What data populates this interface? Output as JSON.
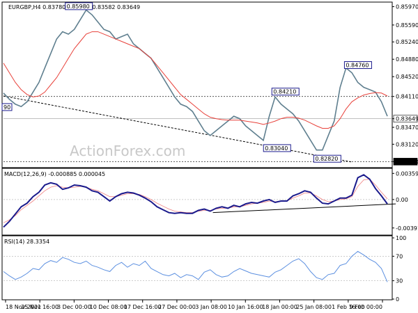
{
  "chart_data": [
    {
      "type": "line",
      "title": "EURGBP,H4  0.83780 0.83823 0.83582 0.83649",
      "watermark": "ActionForex.com",
      "ylim": [
        0.8265,
        0.8605
      ],
      "y_ticks": [
        "0.85970",
        "0.85590",
        "0.85240",
        "0.84880",
        "0.84520",
        "0.84110",
        "0.83649",
        "0.83470",
        "0.83120",
        "0.82760"
      ],
      "x_ticks": [
        "18 Nov 2021",
        "25 Nov 16:00",
        "3 Dec 00:00",
        "10 Dec 08:00",
        "17 Dec 16:00",
        "27 Dec 00:00",
        "3 Jan 08:00",
        "10 Jan 16:00",
        "18 Jan 00:00",
        "25 Jan 08:00",
        "1 Feb 16:00",
        "9 Feb 00:00"
      ],
      "annotations": [
        {
          "text": "0.85980",
          "x": "3 Dec 00:00",
          "y": 0.8598
        },
        {
          "text": "0.84210",
          "x": "18 Jan 00:00",
          "y": 0.8421
        },
        {
          "text": "0.84760",
          "x": "1 Feb 16:00",
          "y": 0.8476
        },
        {
          "text": "0.83040",
          "x": "18 Jan 00:00",
          "y": 0.8304
        },
        {
          "text": "0.82820",
          "x": "25 Jan 08:00",
          "y": 0.8282
        },
        {
          "text": "90",
          "x": "18 Nov 2021",
          "y": 0.8389
        }
      ],
      "current_price": "0.83649",
      "hline_level": "0.84110",
      "series": [
        {
          "values": [
            0.8418,
            0.8405,
            0.8395,
            0.839,
            0.84,
            0.842,
            0.844,
            0.847,
            0.85,
            0.853,
            0.8545,
            0.854,
            0.855,
            0.857,
            0.859,
            0.858,
            0.8565,
            0.855,
            0.8545,
            0.853,
            0.8535,
            0.854,
            0.852,
            0.851,
            0.85,
            0.849,
            0.847,
            0.845,
            0.843,
            0.841,
            0.8395,
            0.839,
            0.838,
            0.836,
            0.834,
            0.833,
            0.834,
            0.835,
            0.836,
            0.837,
            0.8365,
            0.835,
            0.834,
            0.833,
            0.832,
            0.837,
            0.841,
            0.8395,
            0.8385,
            0.8375,
            0.836,
            0.834,
            0.832,
            0.83,
            0.83,
            0.833,
            0.836,
            0.843,
            0.847,
            0.846,
            0.844,
            0.843,
            0.8425,
            0.842,
            0.84,
            0.837
          ]
        },
        {
          "values": [
            0.848,
            0.846,
            0.844,
            0.8425,
            0.8415,
            0.841,
            0.8412,
            0.842,
            0.8435,
            0.845,
            0.847,
            0.849,
            0.851,
            0.8525,
            0.854,
            0.8545,
            0.8545,
            0.854,
            0.8535,
            0.853,
            0.8525,
            0.852,
            0.8515,
            0.851,
            0.85,
            0.849,
            0.8475,
            0.846,
            0.8445,
            0.843,
            0.8415,
            0.8405,
            0.8395,
            0.8385,
            0.8375,
            0.8368,
            0.8365,
            0.8363,
            0.8362,
            0.8362,
            0.8362,
            0.836,
            0.8358,
            0.8356,
            0.8353,
            0.8356,
            0.836,
            0.8365,
            0.8368,
            0.8368,
            0.8366,
            0.8362,
            0.8356,
            0.835,
            0.8345,
            0.8345,
            0.835,
            0.8365,
            0.8385,
            0.84,
            0.8408,
            0.8414,
            0.8417,
            0.8419,
            0.8418,
            0.8412
          ]
        }
      ],
      "trendline": {
        "from": [
          0.8412,
          "18 Nov 2021"
        ],
        "to": [
          0.8275,
          "1 Feb 16:00"
        ]
      }
    },
    {
      "type": "line",
      "title": "MACD(12,26,9) -0.000885 0.000045",
      "ylim": [
        -0.0047,
        0.0041
      ],
      "y_ticks": [
        "0.003592",
        "0.00",
        "-0.003911"
      ],
      "series": [
        {
          "values": [
            -0.0038,
            -0.003,
            -0.002,
            -0.001,
            -0.0005,
            0.0004,
            0.001,
            0.002,
            0.0023,
            0.0021,
            0.0014,
            0.0016,
            0.002,
            0.0019,
            0.0017,
            0.0012,
            0.001,
            0.0004,
            -0.0002,
            0.0004,
            0.0008,
            0.001,
            0.0009,
            0.0006,
            0.0002,
            -0.0003,
            -0.001,
            -0.0014,
            -0.0018,
            -0.0019,
            -0.0018,
            -0.0019,
            -0.0019,
            -0.0015,
            -0.0013,
            -0.0016,
            -0.0012,
            -0.001,
            -0.0012,
            -0.0008,
            -0.001,
            -0.0006,
            -0.0004,
            -0.0005,
            -0.0002,
            0.0,
            -0.0004,
            -0.0002,
            -0.0002,
            0.0005,
            0.0008,
            0.0012,
            0.001,
            0.0002,
            -0.0005,
            -0.0006,
            -0.0002,
            0.0002,
            0.0002,
            0.0006,
            0.003,
            0.0034,
            0.0028,
            0.0015,
            0.0005,
            -0.0006
          ]
        },
        {
          "values": [
            -0.0032,
            -0.0028,
            -0.0022,
            -0.0014,
            -0.0008,
            -0.0002,
            0.0005,
            0.0012,
            0.0017,
            0.0019,
            0.0017,
            0.0016,
            0.0017,
            0.0018,
            0.0017,
            0.0014,
            0.0012,
            0.0008,
            0.0004,
            0.0004,
            0.0006,
            0.0008,
            0.0008,
            0.0007,
            0.0004,
            0.0,
            -0.0005,
            -0.0009,
            -0.0013,
            -0.0016,
            -0.0017,
            -0.0018,
            -0.0018,
            -0.0016,
            -0.0015,
            -0.0015,
            -0.0013,
            -0.0012,
            -0.0012,
            -0.001,
            -0.001,
            -0.0008,
            -0.0006,
            -0.0005,
            -0.0004,
            -0.0002,
            -0.0003,
            -0.0002,
            -0.0002,
            0.0002,
            0.0005,
            0.0009,
            0.0009,
            0.0005,
            0.0,
            -0.0003,
            -0.0002,
            0.0,
            0.0001,
            0.0004,
            0.0018,
            0.0027,
            0.0028,
            0.002,
            0.001,
            0.0001
          ]
        }
      ],
      "trendline": {
        "from": [
          -0.0018,
          "3 Jan 08:00"
        ],
        "to": [
          -0.0006,
          "9 Feb 00:00"
        ]
      }
    },
    {
      "type": "line",
      "title": "RSI(14) 28.3354",
      "ylim": [
        0,
        100
      ],
      "y_ticks": [
        "100",
        "70",
        "30",
        "0"
      ],
      "levels": [
        70,
        30
      ],
      "series": [
        {
          "values": [
            45,
            38,
            32,
            36,
            42,
            50,
            48,
            58,
            63,
            60,
            68,
            65,
            60,
            58,
            62,
            55,
            52,
            48,
            45,
            55,
            60,
            52,
            58,
            55,
            62,
            50,
            45,
            40,
            38,
            42,
            35,
            40,
            38,
            32,
            44,
            48,
            40,
            36,
            38,
            45,
            50,
            46,
            42,
            40,
            38,
            36,
            44,
            48,
            55,
            62,
            66,
            58,
            45,
            35,
            32,
            40,
            42,
            55,
            58,
            70,
            78,
            72,
            65,
            60,
            50,
            28
          ]
        }
      ]
    }
  ]
}
